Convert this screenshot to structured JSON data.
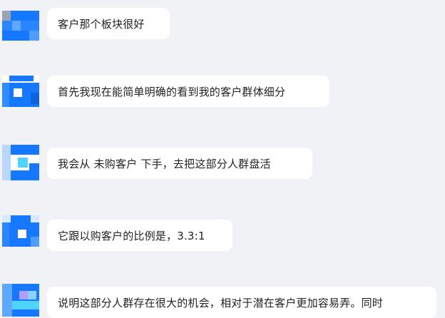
{
  "messages": [
    {
      "text": "客户那个板块很好",
      "avatar": "blurred-avatar"
    },
    {
      "text": "首先我现在能简单明确的看到我的客户群体细分",
      "avatar": "blurred-avatar"
    },
    {
      "text": "我会从 未购客户 下手，去把这部分人群盘活",
      "avatar": "blurred-avatar"
    },
    {
      "text": "它跟以购客户的比例是，3.3:1",
      "avatar": "blurred-avatar"
    },
    {
      "text": "说明这部分人群存在很大的机会，相对于潜在客户更加容易弄。同时",
      "avatar": "blurred-avatar"
    }
  ],
  "colors": {
    "background": "#f0f2f5",
    "bubble": "#ffffff",
    "avatar_blue": "#1677ff",
    "avatar_light": "#5fa8ff",
    "avatar_cyan": "#4fd4ff",
    "avatar_purple": "#b39cff"
  }
}
